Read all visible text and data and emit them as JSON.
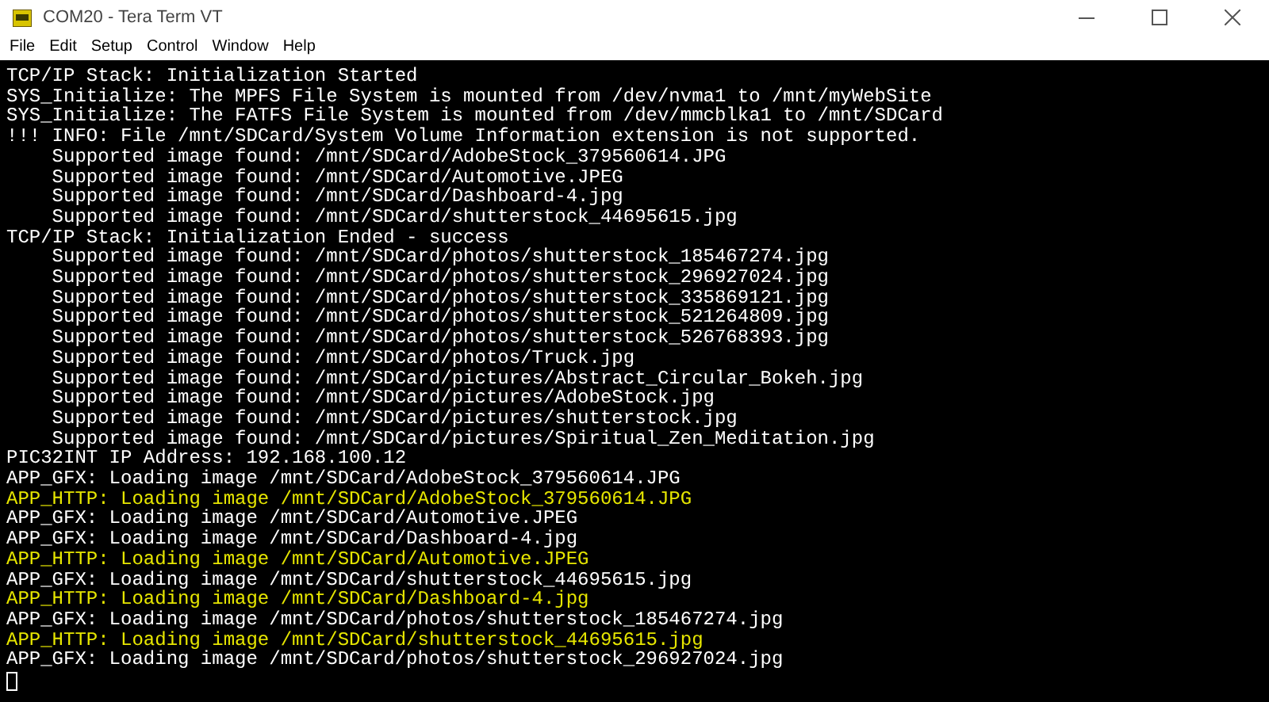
{
  "window": {
    "title": "COM20 - Tera Term VT"
  },
  "menu": [
    "File",
    "Edit",
    "Setup",
    "Control",
    "Window",
    "Help"
  ],
  "terminal": {
    "lines": [
      {
        "text": "TCP/IP Stack: Initialization Started",
        "color": "#ffffff"
      },
      {
        "text": "SYS_Initialize: The MPFS File System is mounted from /dev/nvma1 to /mnt/myWebSite",
        "color": "#ffffff"
      },
      {
        "text": "SYS_Initialize: The FATFS File System is mounted from /dev/mmcblka1 to /mnt/SDCard",
        "color": "#ffffff"
      },
      {
        "text": "!!! INFO: File /mnt/SDCard/System Volume Information extension is not supported.",
        "color": "#ffffff"
      },
      {
        "text": "    Supported image found: /mnt/SDCard/AdobeStock_379560614.JPG",
        "color": "#ffffff"
      },
      {
        "text": "    Supported image found: /mnt/SDCard/Automotive.JPEG",
        "color": "#ffffff"
      },
      {
        "text": "    Supported image found: /mnt/SDCard/Dashboard-4.jpg",
        "color": "#ffffff"
      },
      {
        "text": "    Supported image found: /mnt/SDCard/shutterstock_44695615.jpg",
        "color": "#ffffff"
      },
      {
        "text": "TCP/IP Stack: Initialization Ended - success",
        "color": "#ffffff"
      },
      {
        "text": "    Supported image found: /mnt/SDCard/photos/shutterstock_185467274.jpg",
        "color": "#ffffff"
      },
      {
        "text": "    Supported image found: /mnt/SDCard/photos/shutterstock_296927024.jpg",
        "color": "#ffffff"
      },
      {
        "text": "    Supported image found: /mnt/SDCard/photos/shutterstock_335869121.jpg",
        "color": "#ffffff"
      },
      {
        "text": "    Supported image found: /mnt/SDCard/photos/shutterstock_521264809.jpg",
        "color": "#ffffff"
      },
      {
        "text": "    Supported image found: /mnt/SDCard/photos/shutterstock_526768393.jpg",
        "color": "#ffffff"
      },
      {
        "text": "    Supported image found: /mnt/SDCard/photos/Truck.jpg",
        "color": "#ffffff"
      },
      {
        "text": "    Supported image found: /mnt/SDCard/pictures/Abstract_Circular_Bokeh.jpg",
        "color": "#ffffff"
      },
      {
        "text": "    Supported image found: /mnt/SDCard/pictures/AdobeStock.jpg",
        "color": "#ffffff"
      },
      {
        "text": "    Supported image found: /mnt/SDCard/pictures/shutterstock.jpg",
        "color": "#ffffff"
      },
      {
        "text": "    Supported image found: /mnt/SDCard/pictures/Spiritual_Zen_Meditation.jpg",
        "color": "#ffffff"
      },
      {
        "text": "PIC32INT IP Address: 192.168.100.12",
        "color": "#ffffff"
      },
      {
        "text": "APP_GFX: Loading image /mnt/SDCard/AdobeStock_379560614.JPG",
        "color": "#ffffff"
      },
      {
        "text": "APP_HTTP: Loading image /mnt/SDCard/AdobeStock_379560614.JPG",
        "color": "#e6e600"
      },
      {
        "text": "APP_GFX: Loading image /mnt/SDCard/Automotive.JPEG",
        "color": "#ffffff"
      },
      {
        "text": "APP_GFX: Loading image /mnt/SDCard/Dashboard-4.jpg",
        "color": "#ffffff"
      },
      {
        "text": "APP_HTTP: Loading image /mnt/SDCard/Automotive.JPEG",
        "color": "#e6e600"
      },
      {
        "text": "APP_GFX: Loading image /mnt/SDCard/shutterstock_44695615.jpg",
        "color": "#ffffff"
      },
      {
        "text": "APP_HTTP: Loading image /mnt/SDCard/Dashboard-4.jpg",
        "color": "#e6e600"
      },
      {
        "text": "APP_GFX: Loading image /mnt/SDCard/photos/shutterstock_185467274.jpg",
        "color": "#ffffff"
      },
      {
        "text": "APP_HTTP: Loading image /mnt/SDCard/shutterstock_44695615.jpg",
        "color": "#e6e600"
      },
      {
        "text": "APP_GFX: Loading image /mnt/SDCard/photos/shutterstock_296927024.jpg",
        "color": "#ffffff"
      }
    ]
  }
}
